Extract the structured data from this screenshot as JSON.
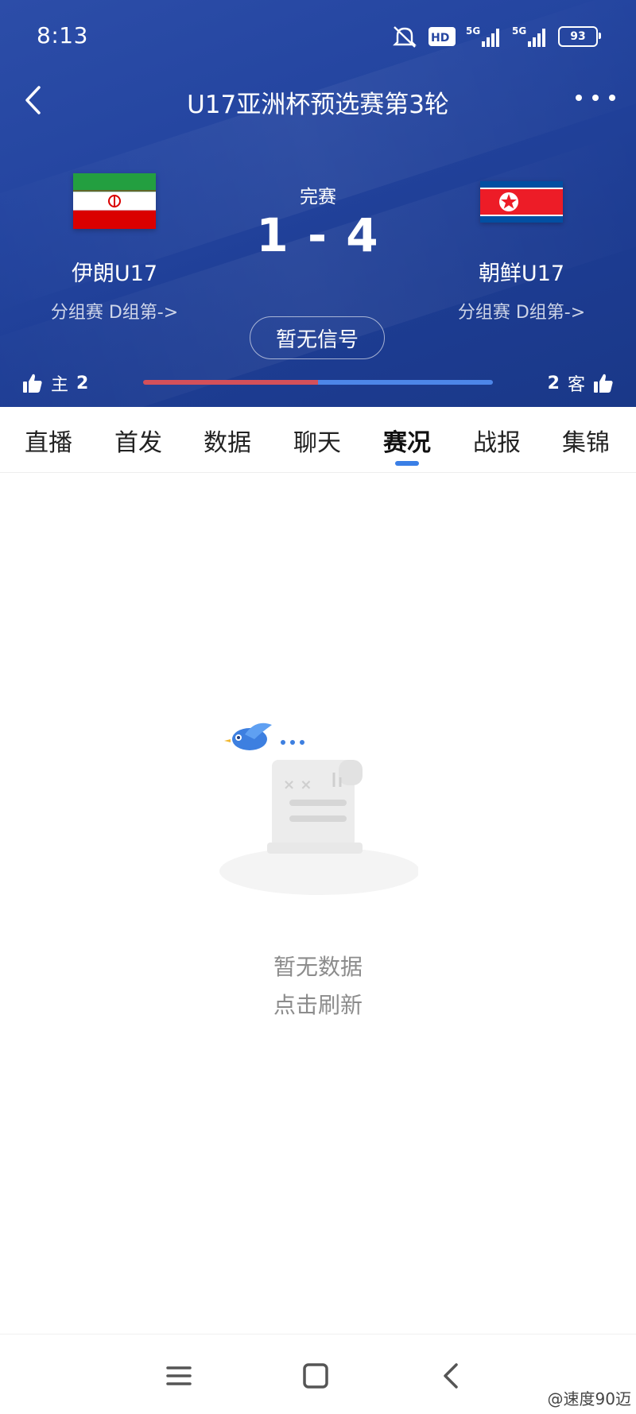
{
  "status_bar": {
    "time": "8:13",
    "hd_label": "HD",
    "network_1": "5G",
    "network_2": "5G",
    "battery": "93"
  },
  "header": {
    "title": "U17亚洲杯预选赛第3轮"
  },
  "match": {
    "status": "完赛",
    "score": "1 - 4",
    "home": {
      "name": "伊朗U17",
      "group": "分组赛 D组第->",
      "flag": "iran-flag"
    },
    "away": {
      "name": "朝鲜U17",
      "group": "分组赛 D组第->",
      "flag": "north-korea-flag"
    },
    "signal_button": "暂无信号"
  },
  "vote": {
    "home_label": "主",
    "home_count": "2",
    "away_label": "客",
    "away_count": "2",
    "home_share": 0.5
  },
  "tabs": [
    {
      "label": "直播"
    },
    {
      "label": "首发"
    },
    {
      "label": "数据"
    },
    {
      "label": "聊天"
    },
    {
      "label": "赛况",
      "active": true
    },
    {
      "label": "战报"
    },
    {
      "label": "集锦"
    }
  ],
  "empty_state": {
    "line1": "暂无数据",
    "line2": "点击刷新"
  },
  "watermark": "@速度90迈",
  "colors": {
    "header_blue": "#2445a0",
    "home_red": "#d3505a",
    "away_blue": "#4d86e8",
    "active_tab_indicator": "#3a7fe6"
  },
  "icons": [
    "mute-icon",
    "signal-icon",
    "battery-icon",
    "back-arrow-icon",
    "more-icon",
    "thumbs-up-icon",
    "bird-icon",
    "document-icon",
    "menu-icon",
    "home-square-icon",
    "back-chevron-icon"
  ]
}
